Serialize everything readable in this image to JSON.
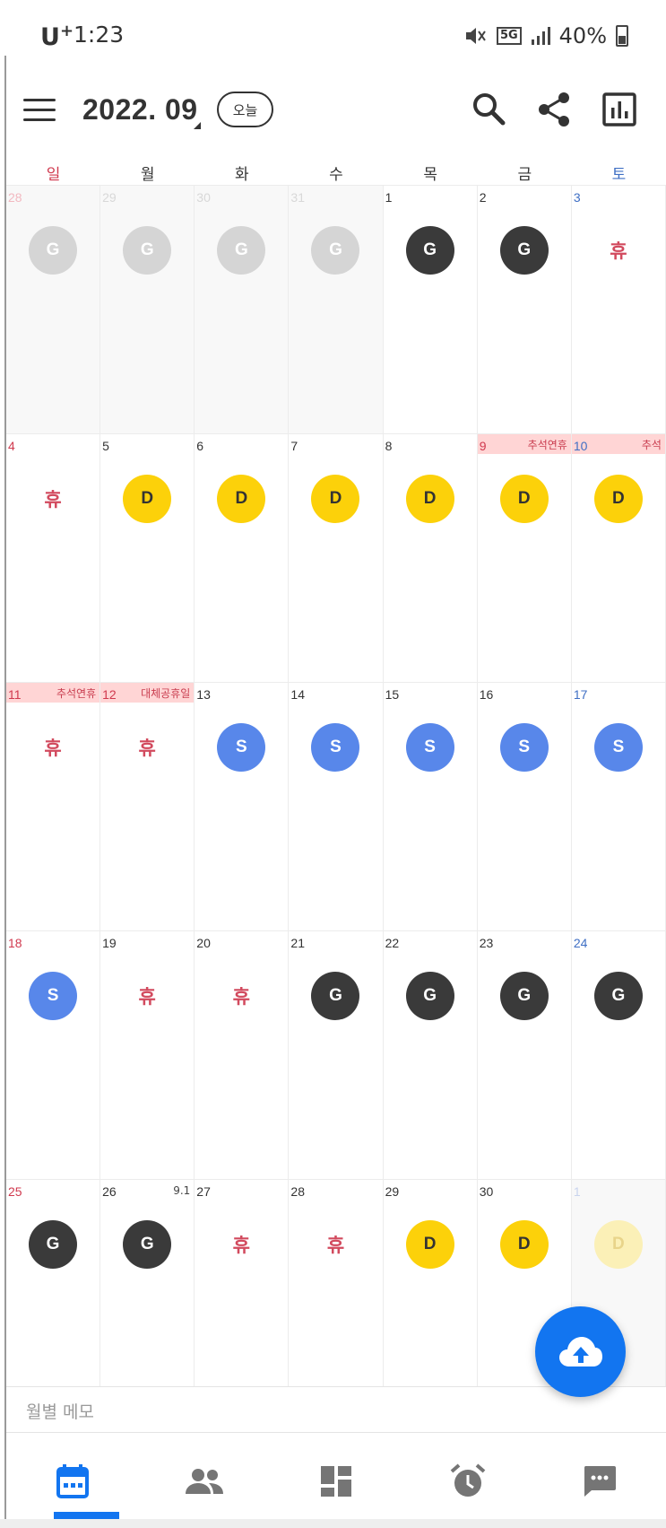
{
  "status_bar": {
    "carrier": "U",
    "carrier_sup": "+",
    "time": "1:23",
    "network": "5G",
    "battery": "40%"
  },
  "header": {
    "month_title": "2022. 09",
    "today_label": "오늘"
  },
  "weekdays": [
    "일",
    "월",
    "화",
    "수",
    "목",
    "금",
    "토"
  ],
  "colors": {
    "sunday": "#d0394e",
    "saturday": "#3f6fc4",
    "shift_G": "#3a3a3a",
    "shift_D": "#fcd10a",
    "shift_S": "#5887ea",
    "rest": "#d24a5e",
    "holiday_banner": "#ffd5d5",
    "accent": "#1275f0"
  },
  "weeks": [
    [
      {
        "day": "28",
        "other": true,
        "shift": "G"
      },
      {
        "day": "29",
        "other": true,
        "shift": "G"
      },
      {
        "day": "30",
        "other": true,
        "shift": "G"
      },
      {
        "day": "31",
        "other": true,
        "shift": "G"
      },
      {
        "day": "1",
        "shift": "G"
      },
      {
        "day": "2",
        "shift": "G"
      },
      {
        "day": "3",
        "shift": "휴"
      }
    ],
    [
      {
        "day": "4",
        "shift": "휴"
      },
      {
        "day": "5",
        "shift": "D"
      },
      {
        "day": "6",
        "shift": "D"
      },
      {
        "day": "7",
        "shift": "D"
      },
      {
        "day": "8",
        "shift": "D"
      },
      {
        "day": "9",
        "holiday": "추석연휴",
        "shift": "D"
      },
      {
        "day": "10",
        "holiday": "추석",
        "shift": "D"
      }
    ],
    [
      {
        "day": "11",
        "holiday": "추석연휴",
        "shift": "휴"
      },
      {
        "day": "12",
        "holiday": "대체공휴일",
        "shift": "휴"
      },
      {
        "day": "13",
        "shift": "S"
      },
      {
        "day": "14",
        "shift": "S"
      },
      {
        "day": "15",
        "shift": "S"
      },
      {
        "day": "16",
        "shift": "S"
      },
      {
        "day": "17",
        "shift": "S"
      }
    ],
    [
      {
        "day": "18",
        "shift": "S"
      },
      {
        "day": "19",
        "shift": "휴"
      },
      {
        "day": "20",
        "shift": "휴"
      },
      {
        "day": "21",
        "shift": "G"
      },
      {
        "day": "22",
        "shift": "G"
      },
      {
        "day": "23",
        "shift": "G"
      },
      {
        "day": "24",
        "shift": "G"
      }
    ],
    [
      {
        "day": "25",
        "shift": "G"
      },
      {
        "day": "26",
        "lunar": "9.1",
        "shift": "G"
      },
      {
        "day": "27",
        "shift": "휴"
      },
      {
        "day": "28",
        "shift": "휴"
      },
      {
        "day": "29",
        "shift": "D"
      },
      {
        "day": "30",
        "shift": "D"
      },
      {
        "day": "1",
        "other": true,
        "shift": "D"
      }
    ]
  ],
  "memo": {
    "placeholder": "월별 메모"
  },
  "fab": {
    "icon": "cloud-upload-icon"
  },
  "bottom_nav": {
    "items": [
      {
        "icon": "calendar-icon",
        "active": true
      },
      {
        "icon": "people-icon"
      },
      {
        "icon": "dashboard-icon"
      },
      {
        "icon": "alarm-icon"
      },
      {
        "icon": "chat-icon"
      }
    ]
  }
}
